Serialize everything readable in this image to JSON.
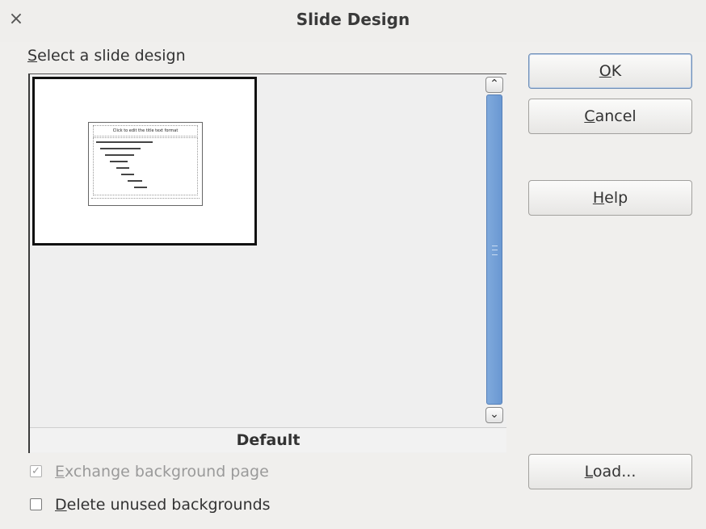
{
  "window": {
    "title": "Slide Design",
    "close_glyph": "×"
  },
  "labels": {
    "select_design_mnemonic": "S",
    "select_design_rest": "elect a slide design"
  },
  "design_list": {
    "items": [
      {
        "name": "Default",
        "thumbnail_title": "Click to edit the title text format"
      }
    ],
    "scroll_up_glyph": "⌃",
    "scroll_down_glyph": "⌄"
  },
  "buttons": {
    "ok": {
      "mnemonic": "O",
      "rest": "K"
    },
    "cancel": {
      "mnemonic": "C",
      "rest": "ancel"
    },
    "help": {
      "mnemonic": "H",
      "rest": "elp"
    },
    "load": {
      "mnemonic": "L",
      "rest": "oad..."
    }
  },
  "options": {
    "exchange_background": {
      "mnemonic": "E",
      "rest": "xchange background page",
      "checked_glyph": "✓",
      "checked": true,
      "enabled": false
    },
    "delete_unused": {
      "mnemonic": "D",
      "rest": "elete unused backgrounds",
      "checked_glyph": "",
      "checked": false,
      "enabled": true
    }
  },
  "colors": {
    "scrollbar_thumb": "#6a98d2",
    "dialog_bg": "#f0efed"
  }
}
